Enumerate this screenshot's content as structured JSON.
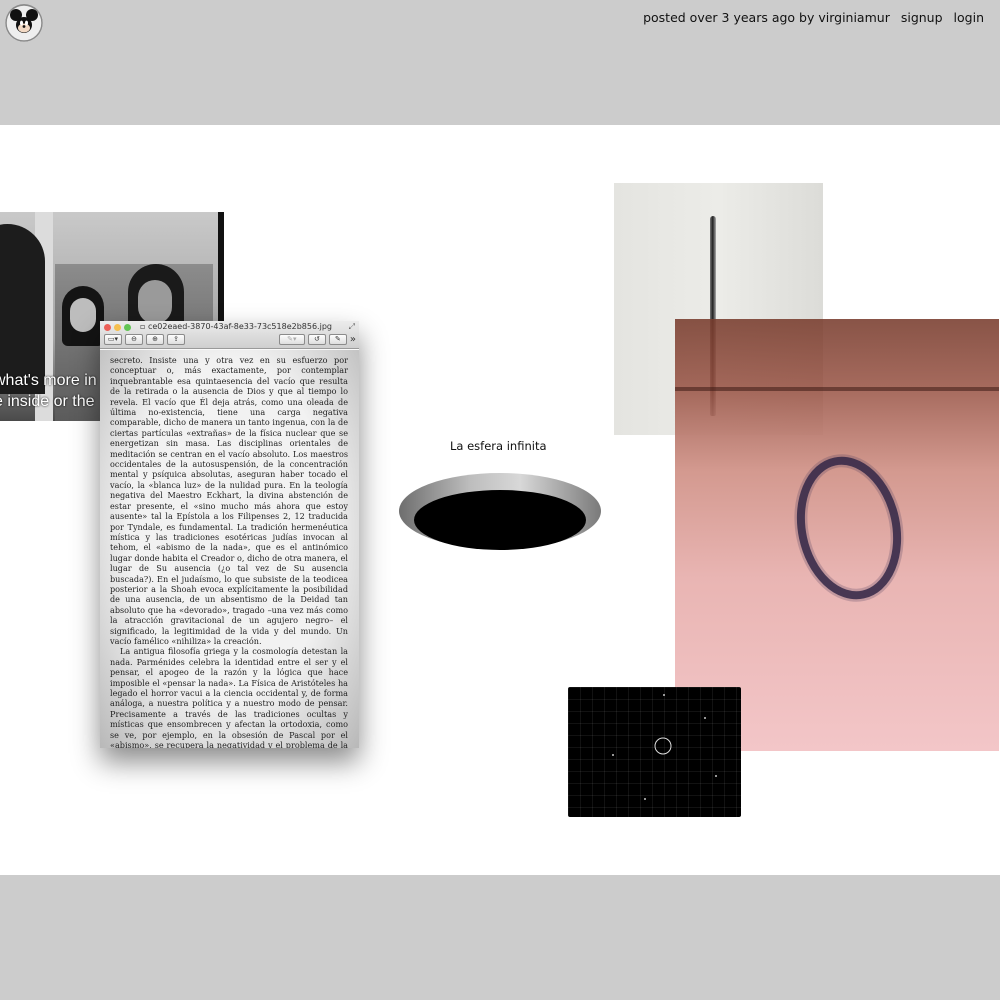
{
  "header": {
    "posted_line": "posted over 3 years ago by virginiamur",
    "signup": "signup",
    "login": "login"
  },
  "film": {
    "subtitle_line1": "what's more in",
    "subtitle_line2": "e inside or the"
  },
  "preview_window": {
    "filename": "ce02eaed-3870-43af-8e33-73c518e2b856.jpg",
    "paragraphs": [
      "secreto. Insiste una y otra vez en su esfuerzo por conceptuar o, más exactamente, por contemplar inquebrantable esa quintaesencia del vacío que resulta de la retirada o la ausencia de Dios y que al tiempo lo revela. El vacío que Él deja atrás, como una oleada de última no-existencia, tiene una carga negativa comparable, dicho de manera un tanto ingenua, con la de ciertas partículas «extrañas» de la física nuclear que se energetizan sin masa. Las disciplinas orientales de meditación se centran en el vacío absoluto. Los maestros occidentales de la autosuspensión, de la concentración mental y psíquica absolutas, aseguran haber tocado el vacío, la «blanca luz» de la nulidad pura. En la teología negativa del Maestro Eckhart, la divina abstención de estar presente, el «sino mucho más ahora que estoy ausente» tal la Epístola a los Filipenses 2, 12 traducida por Tyndale, es fundamental. La tradición hermenéutica mística y las tradiciones esotéricas judías invocan al tehom, el «abismo de la nada», que es el antinómico lugar donde habita el Creador o, dicho de otra manera, el lugar de Su ausencia (¿o tal vez de Su ausencia buscada?). En el judaísmo, lo que subsiste de la teodicea posterior a la Shoah evoca explícitamente la posibilidad de una ausencia, de un absentismo de la Deidad tan absoluto que ha «devorado», tragado –una vez más como la atracción gravitacional de un agujero negro– el significado, la legitimidad de la vida y del mundo. Un vacío famélico «nihiliza» la creación.",
      "La antigua filosofía griega y la cosmología detestan la nada. Parménides celebra la identidad entre el ser y el pensar, el apogeo de la razón y la lógica que hace imposible el «pensar la nada». La Física de Aristóteles ha legado el horror vacui a la ciencia occidental y, de forma análoga, a nuestra política y a nuestro modo de pensar. Precisamente a través de las tradiciones ocultas y místicas que ensombrecen y afectan la ortodoxia, como se ve, por ejemplo, en la obsesión de Pascal por el «abismo», se recupera la negatividad y el problema de la «nada» para la filosofía; incluso mucho después del Sofista de Platón. La lógica hegeliana no hace otra cosa que domes-"
    ]
  },
  "caption": "La esfera infinita",
  "colors": {
    "chrome": "#cccccc",
    "board": "#ffffff",
    "dot_close": "#ec5f57",
    "dot_min": "#f5bf4f",
    "dot_max": "#62c554"
  },
  "icons": {
    "avatar": "mickey-mouse-icon",
    "sidebar_toggle": "sidebar-icon",
    "zoom_out": "zoom-out-icon",
    "zoom_in": "zoom-in-icon",
    "share": "share-icon",
    "annotate": "pen-icon",
    "rotate": "rotate-icon",
    "edit": "edit-icon",
    "more": "chevron-double-right-icon",
    "fullscreen": "expand-icon"
  }
}
